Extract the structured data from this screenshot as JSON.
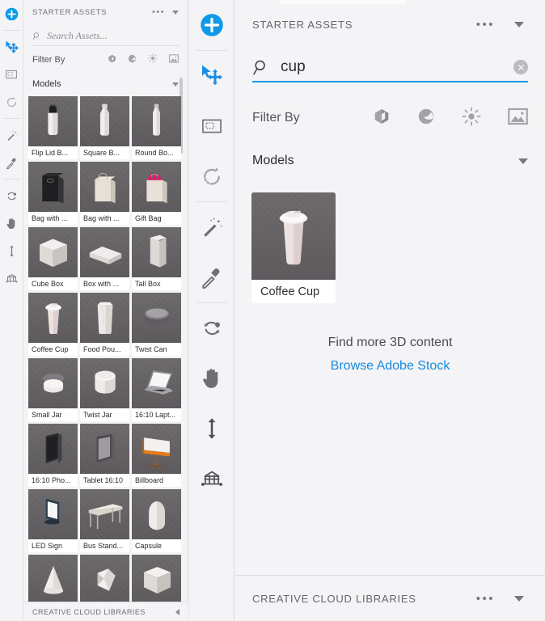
{
  "left_rail": {
    "items": [
      {
        "name": "add-object-tool",
        "icon": "plus-circle-icon",
        "active": true
      },
      {
        "name": "select-move-tool",
        "icon": "cursor-move-icon",
        "active": true
      },
      {
        "name": "scene-frame-tool",
        "icon": "frame-icon",
        "active": false
      },
      {
        "name": "orbit-tool",
        "icon": "rotate-icon",
        "active": false
      },
      {
        "name": "magic-wand-tool",
        "icon": "magic-wand-icon",
        "active": false
      },
      {
        "name": "eyedropper-tool",
        "icon": "eyedropper-icon",
        "active": false
      },
      {
        "name": "rotate-object-tool",
        "icon": "rotate-object-icon",
        "active": false
      },
      {
        "name": "pan-tool",
        "icon": "hand-icon",
        "active": false
      },
      {
        "name": "slide-tool",
        "icon": "vertical-arrows-icon",
        "active": false
      },
      {
        "name": "ground-plane-tool",
        "icon": "ground-plane-icon",
        "active": false
      }
    ]
  },
  "mid_rail": {
    "items": [
      {
        "name": "add-object-tool",
        "icon": "plus-circle-icon",
        "active": true
      },
      {
        "name": "select-move-tool",
        "icon": "cursor-move-icon",
        "active": true
      },
      {
        "name": "scene-frame-tool",
        "icon": "frame-icon",
        "active": false
      },
      {
        "name": "orbit-tool",
        "icon": "rotate-icon",
        "active": false
      },
      {
        "name": "magic-wand-tool",
        "icon": "magic-wand-icon",
        "active": false
      },
      {
        "name": "eyedropper-tool",
        "icon": "eyedropper-icon",
        "active": false
      },
      {
        "name": "rotate-object-tool",
        "icon": "rotate-object-icon",
        "active": false
      },
      {
        "name": "pan-tool",
        "icon": "hand-icon",
        "active": false
      },
      {
        "name": "slide-tool",
        "icon": "vertical-arrows-icon",
        "active": false
      },
      {
        "name": "ground-plane-tool",
        "icon": "ground-plane-icon",
        "active": false
      }
    ]
  },
  "left_panel": {
    "title": "STARTER ASSETS",
    "options_icon": "•••",
    "collapse_icon": "chevron-down-icon",
    "search": {
      "placeholder": "Search Assets...",
      "value": "",
      "icon": "search-icon"
    },
    "filter": {
      "label": "Filter By",
      "icons": [
        "models-cube-icon",
        "materials-sphere-icon",
        "lights-sun-icon",
        "images-picture-icon"
      ]
    },
    "section": {
      "label": "Models",
      "caret": "chevron-down-icon"
    },
    "assets": [
      {
        "label": "Flip Lid B...",
        "shape": "bottle-flip"
      },
      {
        "label": "Square B...",
        "shape": "bottle-square"
      },
      {
        "label": "Round Bo...",
        "shape": "bottle-round"
      },
      {
        "label": "Bag with ...",
        "shape": "bag-dark"
      },
      {
        "label": "Bag with ...",
        "shape": "bag-light"
      },
      {
        "label": "Gift Bag",
        "shape": "bag-gift"
      },
      {
        "label": "Cube Box",
        "shape": "cube-box"
      },
      {
        "label": "Box with ...",
        "shape": "flat-box"
      },
      {
        "label": "Tall Box",
        "shape": "tall-box"
      },
      {
        "label": "Coffee Cup",
        "shape": "coffee-cup"
      },
      {
        "label": "Food Pou...",
        "shape": "pouch"
      },
      {
        "label": "Twist Can",
        "shape": "twist-can"
      },
      {
        "label": "Small Jar",
        "shape": "small-jar"
      },
      {
        "label": "Twist Jar",
        "shape": "twist-jar"
      },
      {
        "label": "16:10 Lapt...",
        "shape": "laptop"
      },
      {
        "label": "16:10 Pho...",
        "shape": "phone"
      },
      {
        "label": "Tablet 16:10",
        "shape": "tablet"
      },
      {
        "label": "Billboard",
        "shape": "billboard"
      },
      {
        "label": "LED Sign",
        "shape": "led-sign"
      },
      {
        "label": "Bus Stand...",
        "shape": "bus-stand"
      },
      {
        "label": "Capsule",
        "shape": "capsule"
      },
      {
        "label": "",
        "shape": "cone"
      },
      {
        "label": "",
        "shape": "gem"
      },
      {
        "label": "",
        "shape": "cube"
      }
    ],
    "footer": {
      "title": "CREATIVE CLOUD LIBRARIES",
      "collapse_icon": "chevron-left-icon"
    }
  },
  "right_panel": {
    "title": "STARTER ASSETS",
    "options_icon": "•••",
    "collapse_icon": "chevron-down-icon",
    "search": {
      "icon": "search-icon",
      "value": "cup",
      "placeholder": "Search Assets...",
      "clear_icon": "clear-circle-icon",
      "underline_color": "#0d9ae8"
    },
    "filter": {
      "label": "Filter By",
      "icons": [
        "models-cube-icon",
        "materials-sphere-icon",
        "lights-sun-icon",
        "images-picture-icon"
      ]
    },
    "section": {
      "label": "Models",
      "caret": "chevron-down-icon"
    },
    "results": [
      {
        "label": "Coffee Cup",
        "shape": "coffee-cup"
      }
    ],
    "more": {
      "text": "Find more 3D content",
      "link": "Browse Adobe Stock",
      "link_color": "#138ce0"
    },
    "footer": {
      "title": "CREATIVE CLOUD LIBRARIES",
      "options_icon": "•••",
      "collapse_icon": "chevron-down-icon"
    }
  }
}
